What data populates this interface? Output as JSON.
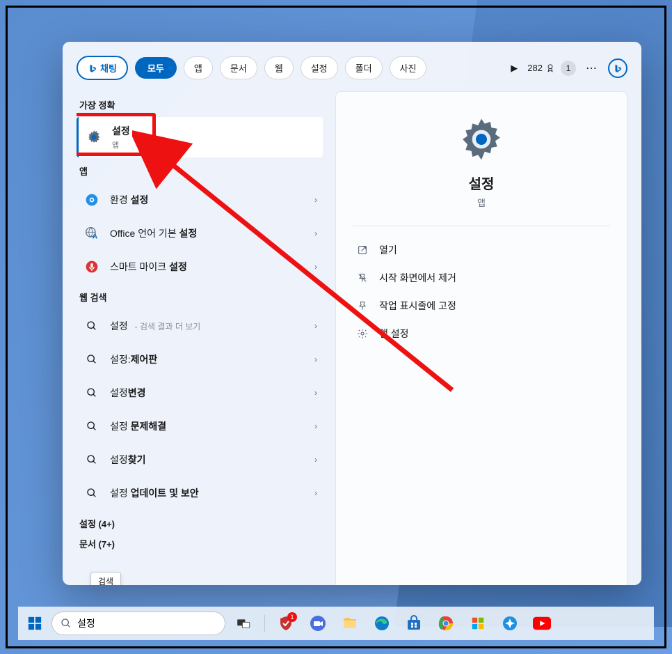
{
  "tabs": {
    "chat": "채팅",
    "all": "모두",
    "apps": "앱",
    "docs": "문서",
    "web": "웹",
    "settings": "설정",
    "folders": "폴더",
    "photos": "사진"
  },
  "toolbar": {
    "points": "282",
    "badge": "1"
  },
  "sections": {
    "best_match": "가장 정확",
    "apps": "앱",
    "web_search": "웹 검색",
    "settings_more": "설정 (4+)",
    "documents_more": "문서 (7+)"
  },
  "best_match": {
    "title": "설정",
    "subtitle": "앱"
  },
  "app_results": [
    {
      "prefix": "환경 ",
      "bold": "설정"
    },
    {
      "prefix": "Office 언어 기본 ",
      "bold": "설정"
    },
    {
      "prefix": "스마트 마이크 ",
      "bold": "설정"
    }
  ],
  "web_results": [
    {
      "prefix": "설정 ",
      "bold": "",
      "hint": "- 검색 결과 더 보기"
    },
    {
      "prefix": "설정:",
      "bold": "제어판",
      "hint": ""
    },
    {
      "prefix": "설정",
      "bold": "변경",
      "hint": ""
    },
    {
      "prefix": "설정 ",
      "bold": "문제해결",
      "hint": ""
    },
    {
      "prefix": "설정",
      "bold": "찾기",
      "hint": ""
    },
    {
      "prefix": "설정 ",
      "bold": "업데이트 및 보안",
      "hint": ""
    }
  ],
  "preview": {
    "title": "설정",
    "subtitle": "앱",
    "actions": {
      "open": "열기",
      "unpin_start": "시작 화면에서 제거",
      "pin_taskbar": "작업 표시줄에 고정",
      "app_settings": "앱 설정"
    }
  },
  "tooltip": "검색",
  "taskbar": {
    "search_value": "설정"
  }
}
